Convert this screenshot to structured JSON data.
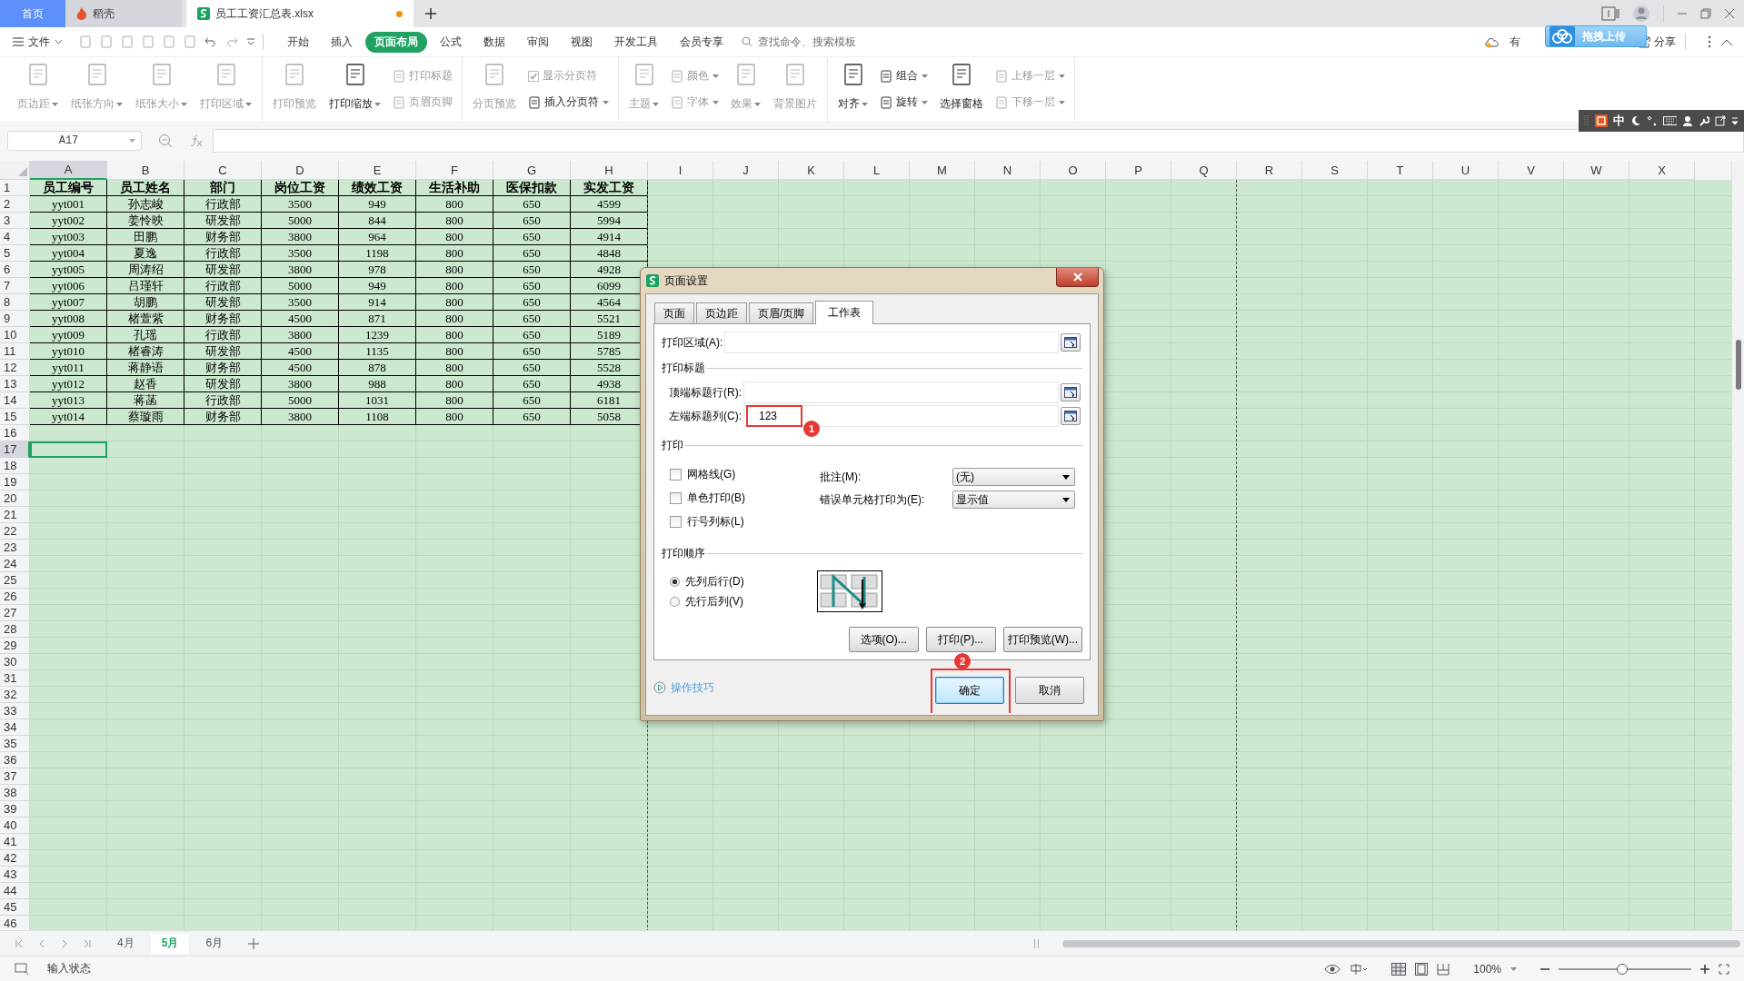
{
  "tabs": [
    {
      "label": "首页",
      "kind": "home",
      "selected": false,
      "unsaved": false
    },
    {
      "label": "稻壳",
      "kind": "docer",
      "selected": false,
      "unsaved": false
    },
    {
      "label": "员工工资汇总表.xlsx",
      "kind": "sheet",
      "selected": true,
      "unsaved": true
    }
  ],
  "upload_popup": "拖拽上传",
  "menu": {
    "file": "文件",
    "items": [
      {
        "label": "开始",
        "selected": false
      },
      {
        "label": "插入",
        "selected": false
      },
      {
        "label": "页面布局",
        "selected": true
      },
      {
        "label": "公式",
        "selected": false
      },
      {
        "label": "数据",
        "selected": false
      },
      {
        "label": "审阅",
        "selected": false
      },
      {
        "label": "视图",
        "selected": false
      },
      {
        "label": "开发工具",
        "selected": false
      },
      {
        "label": "会员专享",
        "selected": false
      }
    ],
    "search": {
      "placeholder": "查找命令、搜索模板"
    },
    "cloud_label": "有",
    "share": "分享"
  },
  "ribbon": [
    [
      {
        "kind": "large",
        "label": "页边距",
        "disabled": true,
        "dropdown": true
      },
      {
        "kind": "large",
        "label": "纸张方向",
        "disabled": true,
        "dropdown": true
      },
      {
        "kind": "large",
        "label": "纸张大小",
        "disabled": true,
        "dropdown": true
      },
      {
        "kind": "large",
        "label": "打印区域",
        "disabled": true,
        "dropdown": true
      }
    ],
    [
      {
        "kind": "large",
        "label": "打印预览",
        "disabled": true,
        "dropdown": false
      },
      {
        "kind": "large",
        "label": "打印缩放",
        "disabled": false,
        "dropdown": true
      },
      {
        "kind": "stack",
        "items": [
          {
            "kind": "button",
            "label": "打印标题",
            "disabled": true,
            "dropdown": false
          },
          {
            "kind": "button",
            "label": "页眉页脚",
            "disabled": true,
            "dropdown": false
          }
        ]
      }
    ],
    [
      {
        "kind": "large",
        "label": "分页预览",
        "disabled": true,
        "dropdown": false
      },
      {
        "kind": "stack",
        "items": [
          {
            "kind": "checkbox",
            "label": "显示分页符",
            "disabled": true,
            "checked": true
          },
          {
            "kind": "button",
            "label": "插入分页符",
            "disabled": false,
            "dropdown": true
          }
        ]
      }
    ],
    [
      {
        "kind": "large",
        "label": "主题",
        "disabled": true,
        "dropdown": true
      },
      {
        "kind": "stack",
        "items": [
          {
            "kind": "button",
            "label": "颜色",
            "disabled": true,
            "dropdown": true
          },
          {
            "kind": "button",
            "label": "字体",
            "disabled": true,
            "dropdown": true
          }
        ]
      },
      {
        "kind": "large",
        "label": "效果",
        "disabled": true,
        "dropdown": true
      },
      {
        "kind": "large",
        "label": "背景图片",
        "disabled": true,
        "dropdown": false
      }
    ],
    [
      {
        "kind": "large",
        "label": "对齐",
        "disabled": false,
        "dropdown": true
      },
      {
        "kind": "stack",
        "items": [
          {
            "kind": "button",
            "label": "组合",
            "disabled": false,
            "dropdown": true
          },
          {
            "kind": "button",
            "label": "旋转",
            "disabled": false,
            "dropdown": true
          }
        ]
      },
      {
        "kind": "large",
        "label": "选择窗格",
        "disabled": false,
        "dropdown": false
      },
      {
        "kind": "stack",
        "items": [
          {
            "kind": "button",
            "label": "上移一层",
            "disabled": true,
            "dropdown": true
          },
          {
            "kind": "button",
            "label": "下移一层",
            "disabled": true,
            "dropdown": true
          }
        ]
      }
    ]
  ],
  "ime": {
    "mode": "中"
  },
  "formula_bar": {
    "name_box": "A17"
  },
  "sheet": {
    "columns": [
      {
        "label": "A",
        "selected": true,
        "page_break_after": false
      },
      {
        "label": "B",
        "selected": false,
        "page_break_after": false
      },
      {
        "label": "C",
        "selected": false,
        "page_break_after": false
      },
      {
        "label": "D",
        "selected": false,
        "page_break_after": false
      },
      {
        "label": "E",
        "selected": false,
        "page_break_after": false
      },
      {
        "label": "F",
        "selected": false,
        "page_break_after": false
      },
      {
        "label": "G",
        "selected": false,
        "page_break_after": false
      },
      {
        "label": "H",
        "selected": false,
        "page_break_after": true
      },
      {
        "label": "I",
        "selected": false,
        "page_break_after": false
      },
      {
        "label": "J",
        "selected": false,
        "page_break_after": false
      },
      {
        "label": "K",
        "selected": false,
        "page_break_after": false
      },
      {
        "label": "L",
        "selected": false,
        "page_break_after": false
      },
      {
        "label": "M",
        "selected": false,
        "page_break_after": false
      },
      {
        "label": "N",
        "selected": false,
        "page_break_after": false
      },
      {
        "label": "O",
        "selected": false,
        "page_break_after": false
      },
      {
        "label": "P",
        "selected": false,
        "page_break_after": false
      },
      {
        "label": "Q",
        "selected": false,
        "page_break_after": true
      },
      {
        "label": "R",
        "selected": false,
        "page_break_after": false
      },
      {
        "label": "S",
        "selected": false,
        "page_break_after": false
      },
      {
        "label": "T",
        "selected": false,
        "page_break_after": false
      },
      {
        "label": "U",
        "selected": false,
        "page_break_after": false
      },
      {
        "label": "V",
        "selected": false,
        "page_break_after": false
      },
      {
        "label": "W",
        "selected": false,
        "page_break_after": false
      },
      {
        "label": "X",
        "selected": false,
        "page_break_after": false
      }
    ],
    "row_numbers": [
      {
        "label": "1",
        "selected": false
      },
      {
        "label": "2",
        "selected": false
      },
      {
        "label": "3",
        "selected": false
      },
      {
        "label": "4",
        "selected": false
      },
      {
        "label": "5",
        "selected": false
      },
      {
        "label": "6",
        "selected": false
      },
      {
        "label": "7",
        "selected": false
      },
      {
        "label": "8",
        "selected": false
      },
      {
        "label": "9",
        "selected": false
      },
      {
        "label": "10",
        "selected": false
      },
      {
        "label": "11",
        "selected": false
      },
      {
        "label": "12",
        "selected": false
      },
      {
        "label": "13",
        "selected": false
      },
      {
        "label": "14",
        "selected": false
      },
      {
        "label": "15",
        "selected": false
      },
      {
        "label": "16",
        "selected": false
      },
      {
        "label": "17",
        "selected": true
      },
      {
        "label": "18",
        "selected": false
      },
      {
        "label": "19",
        "selected": false
      },
      {
        "label": "20",
        "selected": false
      },
      {
        "label": "21",
        "selected": false
      },
      {
        "label": "22",
        "selected": false
      },
      {
        "label": "23",
        "selected": false
      },
      {
        "label": "24",
        "selected": false
      },
      {
        "label": "25",
        "selected": false
      },
      {
        "label": "26",
        "selected": false
      },
      {
        "label": "27",
        "selected": false
      },
      {
        "label": "28",
        "selected": false
      },
      {
        "label": "29",
        "selected": false
      },
      {
        "label": "30",
        "selected": false
      },
      {
        "label": "31",
        "selected": false
      },
      {
        "label": "32",
        "selected": false
      },
      {
        "label": "33",
        "selected": false
      },
      {
        "label": "34",
        "selected": false
      },
      {
        "label": "35",
        "selected": false
      },
      {
        "label": "36",
        "selected": false
      },
      {
        "label": "37",
        "selected": false
      },
      {
        "label": "38",
        "selected": false
      },
      {
        "label": "39",
        "selected": false
      },
      {
        "label": "40",
        "selected": false
      },
      {
        "label": "41",
        "selected": false
      },
      {
        "label": "42",
        "selected": false
      },
      {
        "label": "43",
        "selected": false
      },
      {
        "label": "44",
        "selected": false
      },
      {
        "label": "45",
        "selected": false
      },
      {
        "label": "46",
        "selected": false
      }
    ],
    "rows": [
      [
        "员工编号",
        "员工姓名",
        "部门",
        "岗位工资",
        "绩效工资",
        "生活补助",
        "医保扣款",
        "实发工资"
      ],
      [
        "yyt001",
        "孙志峻",
        "行政部",
        "3500",
        "949",
        "800",
        "650",
        "4599"
      ],
      [
        "yyt002",
        "姜怜映",
        "研发部",
        "5000",
        "844",
        "800",
        "650",
        "5994"
      ],
      [
        "yyt003",
        "田鹏",
        "财务部",
        "3800",
        "964",
        "800",
        "650",
        "4914"
      ],
      [
        "yyt004",
        "夏逸",
        "行政部",
        "3500",
        "1198",
        "800",
        "650",
        "4848"
      ],
      [
        "yyt005",
        "周涛绍",
        "研发部",
        "3800",
        "978",
        "800",
        "650",
        "4928"
      ],
      [
        "yyt006",
        "吕瑾轩",
        "行政部",
        "5000",
        "949",
        "800",
        "650",
        "6099"
      ],
      [
        "yyt007",
        "胡鹏",
        "研发部",
        "3500",
        "914",
        "800",
        "650",
        "4564"
      ],
      [
        "yyt008",
        "楮萱紫",
        "财务部",
        "4500",
        "871",
        "800",
        "650",
        "5521"
      ],
      [
        "yyt009",
        "孔瑶",
        "行政部",
        "3800",
        "1239",
        "800",
        "650",
        "5189"
      ],
      [
        "yyt010",
        "楮睿涛",
        "研发部",
        "4500",
        "1135",
        "800",
        "650",
        "5785"
      ],
      [
        "yyt011",
        "蒋静语",
        "财务部",
        "4500",
        "878",
        "800",
        "650",
        "5528"
      ],
      [
        "yyt012",
        "赵香",
        "研发部",
        "3800",
        "988",
        "800",
        "650",
        "4938"
      ],
      [
        "yyt013",
        "蒋菡",
        "行政部",
        "5000",
        "1031",
        "800",
        "650",
        "6181"
      ],
      [
        "yyt014",
        "蔡璇雨",
        "财务部",
        "3800",
        "1108",
        "800",
        "650",
        "5058"
      ]
    ]
  },
  "dialog": {
    "title": "页面设置",
    "tabs": [
      {
        "label": "页面",
        "selected": false
      },
      {
        "label": "页边距",
        "selected": false
      },
      {
        "label": "页眉/页脚",
        "selected": false
      },
      {
        "label": "工作表",
        "selected": true
      }
    ],
    "print_area": {
      "label": "打印区域(A):"
    },
    "print_titles": {
      "heading": "打印标题",
      "fields": [
        {
          "label": "顶端标题行(R):",
          "highlighted": false
        },
        {
          "label": "左端标题列(C):",
          "value": "123",
          "highlighted": true,
          "badge": "1"
        }
      ]
    },
    "print": {
      "heading": "打印",
      "checkboxes": [
        {
          "label": "网格线(G)",
          "checked": false
        },
        {
          "label": "单色打印(B)",
          "checked": false
        },
        {
          "label": "行号列标(L)",
          "checked": false
        }
      ],
      "selects": [
        {
          "label": "批注(M):",
          "value": "(无)"
        },
        {
          "label": "错误单元格打印为(E):",
          "value": "显示值"
        }
      ]
    },
    "print_order": {
      "heading": "打印顺序",
      "options": [
        {
          "label": "先列后行(D)",
          "selected": true
        },
        {
          "label": "先行后列(V)",
          "selected": false
        }
      ]
    },
    "buttons": [
      "选项(O)...",
      "打印(P)...",
      "打印预览(W)..."
    ],
    "tips_link": "操作技巧",
    "footer_buttons": [
      {
        "label": "确定",
        "kind": "primary",
        "highlighted": true,
        "badge": "2"
      },
      {
        "label": "取消",
        "kind": "default",
        "highlighted": false
      }
    ]
  },
  "sheet_tabs": [
    {
      "label": "4月",
      "selected": false
    },
    {
      "label": "5月",
      "selected": true
    },
    {
      "label": "6月",
      "selected": false
    }
  ],
  "status_bar": {
    "text": "输入状态",
    "zoom": "100%",
    "zoom_slider": {
      "level": 0.48
    }
  }
}
